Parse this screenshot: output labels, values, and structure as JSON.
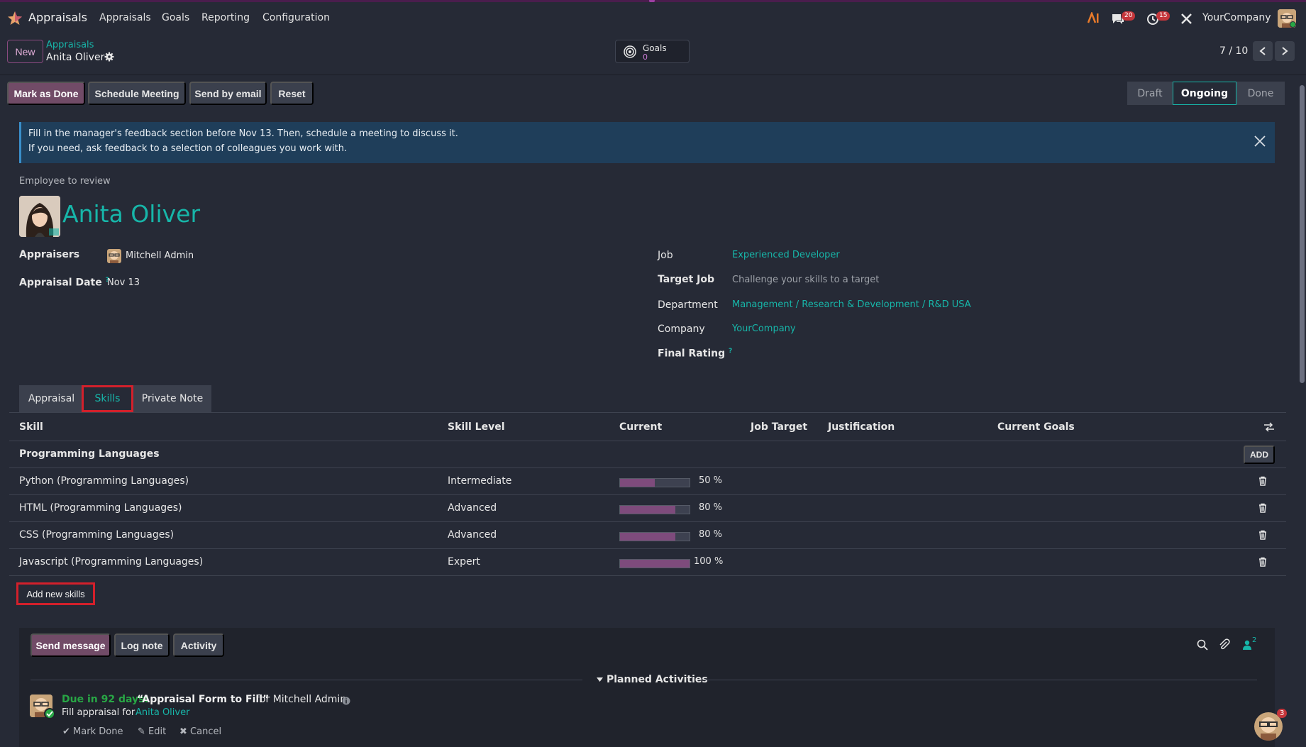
{
  "navbar": {
    "app_title": "Appraisals",
    "menu": [
      "Appraisals",
      "Goals",
      "Reporting",
      "Configuration"
    ],
    "messages_count": "20",
    "activities_count": "15",
    "company": "YourCompany"
  },
  "control_panel": {
    "new_label": "New",
    "breadcrumb_parent": "Appraisals",
    "breadcrumb_current": "Anita Oliver",
    "goals_label": "Goals",
    "goals_value": "0",
    "pager": "7 / 10"
  },
  "statusbar": {
    "buttons": [
      "Mark as Done",
      "Schedule Meeting",
      "Send by email",
      "Reset"
    ],
    "stages": [
      "Draft",
      "Ongoing",
      "Done"
    ],
    "active_stage": "Ongoing"
  },
  "alert": {
    "line1": "Fill in the manager's feedback section before Nov 13. Then, schedule a meeting to discuss it.",
    "line2": "If you need, ask feedback to a selection of colleagues you work with."
  },
  "employee": {
    "section_label": "Employee to review",
    "name": "Anita Oliver"
  },
  "fields": {
    "appraisers_label": "Appraisers",
    "appraisers_value": "Mitchell Admin",
    "appraisal_date_label": "Appraisal Date",
    "appraisal_date_value": "Nov 13",
    "job_label": "Job",
    "job_value": "Experienced Developer",
    "target_job_label": "Target Job",
    "target_job_placeholder": "Challenge your skills to a target",
    "department_label": "Department",
    "department_value": "Management / Research & Development / R&D USA",
    "company_label": "Company",
    "company_value": "YourCompany",
    "final_rating_label": "Final Rating",
    "help_mark": "?"
  },
  "tabs": [
    "Appraisal",
    "Skills",
    "Private Note"
  ],
  "active_tab": "Skills",
  "skills_table": {
    "headers": [
      "Skill",
      "Skill Level",
      "Current",
      "Job Target",
      "Justification",
      "Current Goals"
    ],
    "group": "Programming Languages",
    "add_label": "ADD",
    "rows": [
      {
        "skill": "Python (Programming Languages)",
        "level": "Intermediate",
        "progress": 50,
        "progress_label": "50 %"
      },
      {
        "skill": "HTML (Programming Languages)",
        "level": "Advanced",
        "progress": 80,
        "progress_label": "80 %"
      },
      {
        "skill": "CSS (Programming Languages)",
        "level": "Advanced",
        "progress": 80,
        "progress_label": "80 %"
      },
      {
        "skill": "Javascript (Programming Languages)",
        "level": "Expert",
        "progress": 100,
        "progress_label": "100 %"
      }
    ],
    "add_new_label": "Add new skills"
  },
  "chatter": {
    "buttons": [
      "Send message",
      "Log note",
      "Activity"
    ],
    "followers_count": "2",
    "planned_title": "Planned Activities",
    "activity": {
      "due": "Due in 92 days:",
      "title": "“Appraisal Form to Fill”",
      "for": "for Mitchell Admin",
      "sub_prefix": "Fill appraisal for",
      "sub_link": "Anita Oliver",
      "ops": [
        "Mark Done",
        "Edit",
        "Cancel"
      ]
    },
    "bot_badge": "3"
  },
  "colors": {
    "accent": "#17b6a9",
    "primary": "#714b67",
    "background": "#262a36",
    "highlight_box": "#d3202b"
  }
}
